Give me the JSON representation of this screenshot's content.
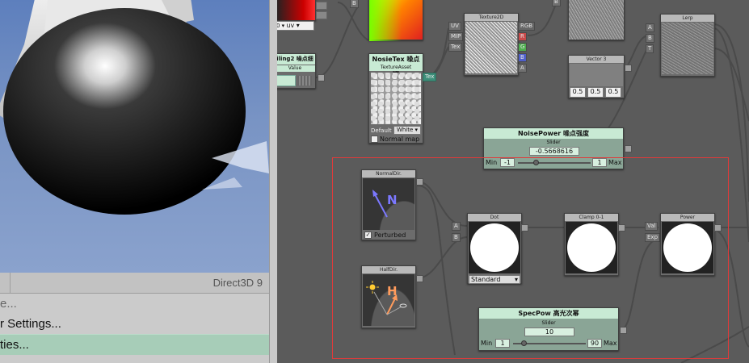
{
  "viewport": {
    "api_label": "Direct3D 9"
  },
  "menu": {
    "items": [
      "e...",
      "r Settings...",
      "ties..."
    ]
  },
  "nodes": {
    "tiling": {
      "title": "iling2 噪点细",
      "value_label": "Value"
    },
    "uv_select": {
      "value": "uv"
    },
    "noise_tex": {
      "title": "NosieTex 噪点图",
      "sub": "TextureAsset",
      "default_label": "Default",
      "default_value": "White",
      "normal_map": "Normal map"
    },
    "texture2d": {
      "title": "Texture2D",
      "in_uv": "UV",
      "in_mip": "MIP",
      "in_tex": "Tex",
      "out_rgb": "RGB",
      "out_r": "R",
      "out_g": "G",
      "out_b": "B",
      "out_a": "A"
    },
    "tex_out": "Tex",
    "vector3": {
      "title": "Vector 3",
      "x": "0.5",
      "y": "0.5",
      "z": "0.5"
    },
    "lerp": {
      "title": "Lerp",
      "in_a": "A",
      "in_b": "B",
      "in_t": "T"
    },
    "noise_power": {
      "title": "NoisePower 噪点强度",
      "sub": "Slider",
      "value": "-0.5668616",
      "min_label": "Min",
      "min": "-1",
      "max": "1",
      "max_label": "Max"
    },
    "normal_dir": {
      "title": "NormalDir.",
      "glyph": "N",
      "perturbed": "Perturbed"
    },
    "half_dir": {
      "title": "HalfDir.",
      "glyph": "H"
    },
    "dot": {
      "title": "Dot",
      "in_a": "A",
      "in_b": "B",
      "mode": "Standard"
    },
    "clamp": {
      "title": "Clamp 0-1"
    },
    "power": {
      "title": "Power",
      "in_val": "Val",
      "in_exp": "Exp"
    },
    "spec_pow": {
      "title": "SpecPow 高光次幂",
      "sub": "Slider",
      "value": "10",
      "min_label": "Min",
      "min": "1",
      "max": "90",
      "max_label": "Max"
    }
  },
  "colors": {
    "canvas": "#5b5b5b",
    "selection": "#e03a3a",
    "node_header_green": "#c8ead4",
    "menu_selected": "#a7cdb8",
    "port_r": "#c94a4a",
    "port_g": "#4fae4f",
    "port_b": "#4f5fc9",
    "normal_glyph": "#7b78ff",
    "half_glyph": "#ff9b5c"
  }
}
